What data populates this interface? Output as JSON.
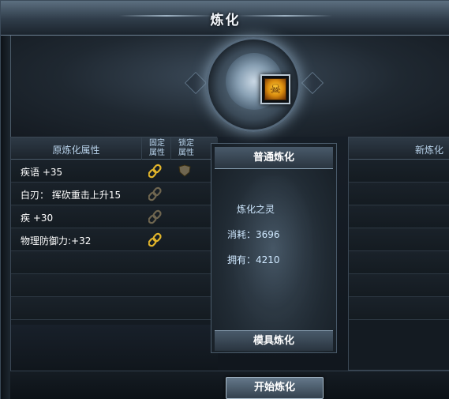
{
  "window": {
    "title": "炼化"
  },
  "colors": {
    "accent": "#b8d2ea",
    "lock_gold": "#e2b52b",
    "lock_dim": "#6f6650",
    "text": "#ffffff"
  },
  "item": {
    "icon": "golden-demon-mask-icon"
  },
  "left_table": {
    "header_attr": "原炼化属性",
    "header_fixed": "固定\n属性",
    "header_locked": "锁定\n属性",
    "rows": [
      {
        "attr": "疾语 +35",
        "fixed_lock": "active",
        "locked_lock": "shield"
      },
      {
        "attr": "白刃： 挥砍重击上升15",
        "fixed_lock": "inactive",
        "locked_lock": ""
      },
      {
        "attr": "疾 +30",
        "fixed_lock": "inactive",
        "locked_lock": ""
      },
      {
        "attr": "物理防御力:+32",
        "fixed_lock": "active",
        "locked_lock": ""
      },
      {
        "attr": "",
        "fixed_lock": "",
        "locked_lock": ""
      },
      {
        "attr": "",
        "fixed_lock": "",
        "locked_lock": ""
      },
      {
        "attr": "",
        "fixed_lock": "",
        "locked_lock": ""
      }
    ]
  },
  "mid_panel": {
    "title": "普通炼化",
    "material_label": "炼化之灵",
    "cost_label": "消耗：",
    "cost_value": "3696",
    "own_label": "拥有：",
    "own_value": "4210",
    "footer": "模具炼化"
  },
  "right_table": {
    "header": "新炼化"
  },
  "start_button": {
    "label": "开始炼化"
  }
}
